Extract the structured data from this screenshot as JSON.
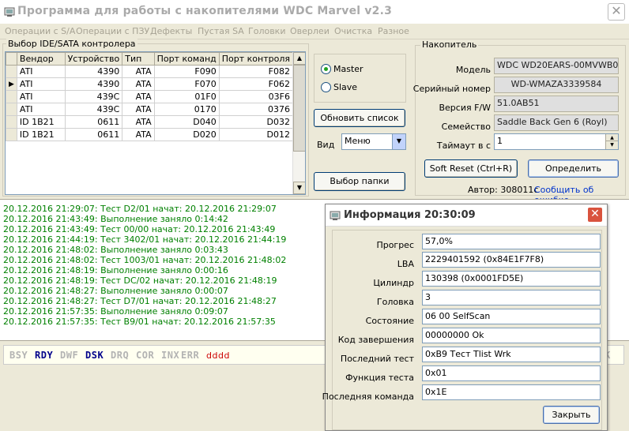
{
  "window": {
    "title": "Программа для работы с накопителями WDC Marvel v2.3",
    "close_label": "✕"
  },
  "menu": [
    "Операции с S/A",
    "Операции с ПЗУ",
    "Дефекты",
    "Пустая SA",
    "Головки",
    "Оверлеи",
    "Очистка",
    "Разное"
  ],
  "device_group": {
    "label": "Выбор IDE/SATA контролера",
    "columns": [
      "Вендор",
      "Устройство",
      "Тип",
      "Порт команд",
      "Порт контроля"
    ],
    "rows": [
      {
        "vendor": "ATI",
        "device": "4390",
        "type": "ATA",
        "cmd": "F090",
        "ctrl": "F082",
        "selected": false
      },
      {
        "vendor": "ATI",
        "device": "4390",
        "type": "ATA",
        "cmd": "F070",
        "ctrl": "F062",
        "selected": true
      },
      {
        "vendor": "ATI",
        "device": "439C",
        "type": "ATA",
        "cmd": "01F0",
        "ctrl": "03F6",
        "selected": false
      },
      {
        "vendor": "ATI",
        "device": "439C",
        "type": "ATA",
        "cmd": "0170",
        "ctrl": "0376",
        "selected": false
      },
      {
        "vendor": "ID 1B21",
        "device": "0611",
        "type": "ATA",
        "cmd": "D040",
        "ctrl": "D032",
        "selected": false
      },
      {
        "vendor": "ID 1B21",
        "device": "0611",
        "type": "ATA",
        "cmd": "D020",
        "ctrl": "D012",
        "selected": false
      }
    ],
    "selected_marker": "▶"
  },
  "controls": {
    "master": "Master",
    "slave": "Slave",
    "master_checked": true,
    "refresh_button": "Обновить список",
    "view_label": "Вид",
    "view_value": "Меню",
    "folder_button": "Выбор папки"
  },
  "drive_group": {
    "label": "Накопитель",
    "model_label": "Модель",
    "model": "WDC WD20EARS-00MVWB0",
    "serial_label": "Серийный номер",
    "serial": "WD-WMAZA3339584",
    "fw_label": "Версия F/W",
    "fw": "51.0AB51",
    "family_label": "Семейство",
    "family": "Saddle Back Gen 6 (Royl)",
    "timeout_label": "Таймаут в с",
    "timeout": "1",
    "soft_reset_button": "Soft Reset (Ctrl+R)",
    "detect_button": "Определить",
    "author_text": "Автор: 308011c",
    "report_link": "Сообщить об ошибке"
  },
  "log": [
    "20.12.2016 21:29:07: Тест D2/01 начат: 20.12.2016 21:29:07",
    "20.12.2016 21:43:49: Выполнение заняло 0:14:42",
    "20.12.2016 21:43:49: Тест 00/00 начат: 20.12.2016 21:43:49",
    "20.12.2016 21:44:19: Тест 3402/01 начат: 20.12.2016 21:44:19",
    "20.12.2016 21:48:02: Выполнение заняло 0:03:43",
    "20.12.2016 21:48:02: Тест 1003/01 начат: 20.12.2016 21:48:02",
    "20.12.2016 21:48:19: Выполнение заняло 0:00:16",
    "20.12.2016 21:48:19: Тест DC/02 начат: 20.12.2016 21:48:19",
    "20.12.2016 21:48:27: Выполнение заняло 0:00:07",
    "20.12.2016 21:48:27: Тест D7/01 начат: 20.12.2016 21:48:27",
    "20.12.2016 21:57:35: Выполнение заняло 0:09:07",
    "20.12.2016 21:57:35: Тест B9/01 начат: 20.12.2016 21:57:35"
  ],
  "status_flags": [
    {
      "name": "BSY",
      "active": false
    },
    {
      "name": "RDY",
      "active": true
    },
    {
      "name": "DWF",
      "active": false
    },
    {
      "name": "DSK",
      "active": true
    },
    {
      "name": "DRQ",
      "active": false
    },
    {
      "name": "COR",
      "active": false
    },
    {
      "name": "INX",
      "active": false
    },
    {
      "name": "ERR",
      "active": false
    }
  ],
  "status_extra": "dddd",
  "status_tail": "K",
  "colors": {
    "active_flag": "#00008b",
    "inactive_flag": "#b3b3b3",
    "log_text": "#008000",
    "extra": "#cc0000"
  },
  "dialog": {
    "title": "Информация 20:30:09",
    "close_label": "✕",
    "fields": [
      {
        "label": "Прогрес",
        "value": "57,0%"
      },
      {
        "label": "LBA",
        "value": "2229401592 (0x84E1F7F8)"
      },
      {
        "label": "Цилиндр",
        "value": "130398 (0x0001FD5E)"
      },
      {
        "label": "Головка",
        "value": "3"
      },
      {
        "label": "Состояние",
        "value": "06 00 SelfScan"
      },
      {
        "label": "Код завершения",
        "value": "00000000 Ok"
      },
      {
        "label": "Последний тест",
        "value": "0xB9 Тест Tlist Wrk"
      },
      {
        "label": "Функция теста",
        "value": "0x01"
      },
      {
        "label": "Последняя команда",
        "value": "0x1E"
      }
    ],
    "close_button": "Закрыть"
  }
}
